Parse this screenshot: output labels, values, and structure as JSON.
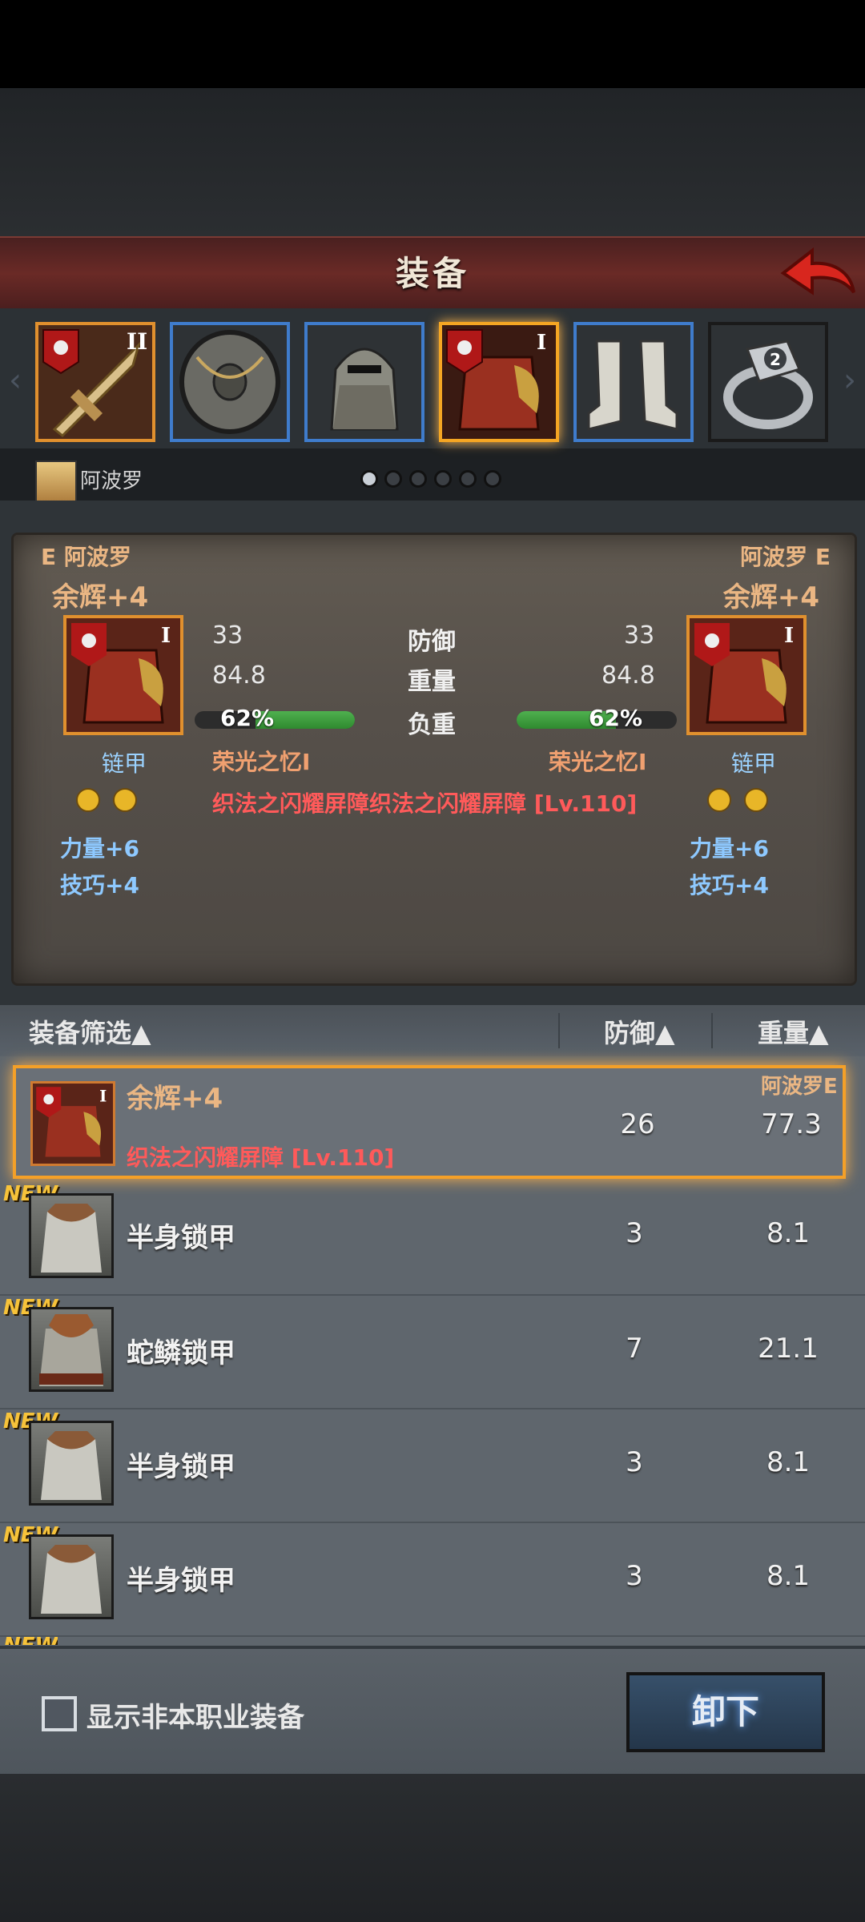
{
  "header": {
    "title": "装备"
  },
  "slots": [
    {
      "name": "weapon",
      "badge": "II"
    },
    {
      "name": "shield",
      "badge": ""
    },
    {
      "name": "helmet",
      "badge": ""
    },
    {
      "name": "armor",
      "badge": "I"
    },
    {
      "name": "boots",
      "badge": ""
    },
    {
      "name": "ring",
      "badge": "2"
    }
  ],
  "character": {
    "name": "阿波罗"
  },
  "compare": {
    "left_header": "E 阿波罗",
    "right_header": "阿波罗 E",
    "left_title": "余辉+4",
    "right_title": "余辉+4",
    "left_defense": "33",
    "right_defense": "33",
    "defense_label": "防御",
    "left_weight": "84.8",
    "right_weight": "84.8",
    "weight_label": "重量",
    "left_load": "62%",
    "right_load": "62%",
    "load_label": "负重",
    "load_fraction": 0.62,
    "left_type": "链甲",
    "right_type": "链甲",
    "left_set": "荣光之忆I",
    "right_set": "荣光之忆I",
    "skill": "织法之闪耀屏障织法之闪耀屏障 [Lv.110]",
    "left_str": "力量+6",
    "left_dex": "技巧+4",
    "right_str": "力量+6",
    "right_dex": "技巧+4"
  },
  "list_header": {
    "filter": "装备筛选▲",
    "defense": "防御▲",
    "weight": "重量▲"
  },
  "items": [
    {
      "name": "余辉+4",
      "sub": "织法之闪耀屏障 [Lv.110]",
      "owner": "阿波罗E",
      "defense": "26",
      "weight": "77.3",
      "new": "",
      "badge": "I"
    },
    {
      "name": "半身锁甲",
      "sub": "",
      "owner": "",
      "defense": "3",
      "weight": "8.1",
      "new": "NEW",
      "badge": ""
    },
    {
      "name": "蛇鳞锁甲",
      "sub": "",
      "owner": "",
      "defense": "7",
      "weight": "21.1",
      "new": "NEW",
      "badge": ""
    },
    {
      "name": "半身锁甲",
      "sub": "",
      "owner": "",
      "defense": "3",
      "weight": "8.1",
      "new": "NEW",
      "badge": ""
    },
    {
      "name": "半身锁甲",
      "sub": "",
      "owner": "",
      "defense": "3",
      "weight": "8.1",
      "new": "NEW",
      "badge": ""
    }
  ],
  "partial_new": "NEW",
  "footer": {
    "checkbox_label": "显示非本职业装备",
    "unequip": "卸下"
  },
  "colors": {
    "accent": "#f4a028",
    "header": "#6a2a26",
    "blue_border": "#3f7ccc"
  }
}
